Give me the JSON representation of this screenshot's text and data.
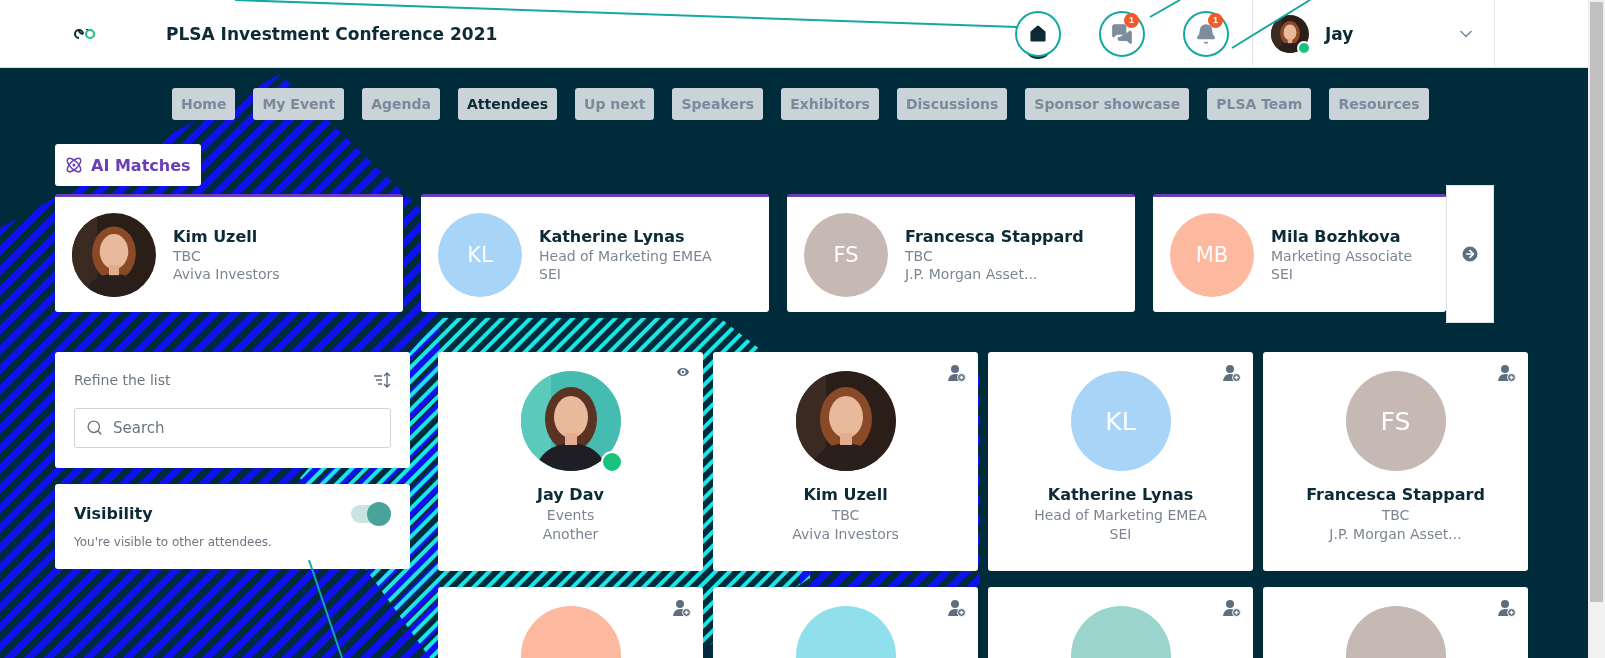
{
  "header": {
    "title": "PLSA Investment Conference 2021",
    "user_name": "Jay",
    "user_online": true
  },
  "nav_icons": [
    {
      "kind": "home",
      "selected": true
    },
    {
      "kind": "chat",
      "selected": false,
      "badge": "1"
    },
    {
      "kind": "bell",
      "selected": false,
      "badge": "1"
    }
  ],
  "tabs": [
    {
      "label": "Home",
      "selected": false
    },
    {
      "label": "My Event",
      "selected": false
    },
    {
      "label": "Agenda",
      "selected": false
    },
    {
      "label": "Attendees",
      "selected": true
    },
    {
      "label": "Up next",
      "selected": false
    },
    {
      "label": "Speakers",
      "selected": false
    },
    {
      "label": "Exhibitors",
      "selected": false
    },
    {
      "label": "Discussions",
      "selected": false
    },
    {
      "label": "Sponsor showcase",
      "selected": false
    },
    {
      "label": "PLSA Team",
      "selected": false
    },
    {
      "label": "Resources",
      "selected": false
    }
  ],
  "ai_matches_button": "AI Matches",
  "matches": [
    {
      "name": "Kim Uzell",
      "title": "TBC",
      "company": "Aviva Investors"
    },
    {
      "kind": "initials",
      "initials": "KL",
      "color": "#a8d4f7",
      "name": "Katherine Lynas",
      "title": "Head of Marketing EMEA",
      "company": "SEI"
    },
    {
      "kind": "initials",
      "initials": "FS",
      "color": "#c6b8b2",
      "name": "Francesca Stappard",
      "title": "TBC",
      "company": "J.P. Morgan Asset..."
    },
    {
      "kind": "initials",
      "initials": "MB",
      "color": "#fdb9a0",
      "name": "Mila Bozhkova",
      "title": "Marketing Associate",
      "company": "SEI"
    }
  ],
  "filter": {
    "heading": "Refine the list",
    "search": {
      "placeholder": "Search"
    }
  },
  "visibility": {
    "heading": "Visibility",
    "on": true,
    "note": "You're visible to other attendees."
  },
  "attendees": [
    {
      "self": true,
      "online": true,
      "name": "Jay Dav",
      "title": "Events",
      "company": "Another"
    },
    {
      "self": false,
      "online": false,
      "name": "Kim Uzell",
      "title": "TBC",
      "company": "Aviva Investors"
    },
    {
      "kind": "initials",
      "initials": "KL",
      "color": "#a8d4f7",
      "self": false,
      "online": false,
      "name": "Katherine Lynas",
      "title": "Head of Marketing EMEA",
      "company": "SEI"
    },
    {
      "kind": "initials",
      "initials": "FS",
      "color": "#c6b8b2",
      "self": false,
      "online": false,
      "name": "Francesca Stappard",
      "title": "TBC",
      "company": "J.P. Morgan Asset..."
    },
    {
      "kind": "initials",
      "color": "#fdb9a0",
      "self": false,
      "online": false
    },
    {
      "kind": "initials",
      "color": "#8fe0ec",
      "self": false,
      "online": false
    },
    {
      "kind": "initials",
      "color": "#9ad4cc",
      "self": false,
      "online": false
    },
    {
      "kind": "initials",
      "color": "#c6b8b2",
      "self": false,
      "online": false
    }
  ]
}
